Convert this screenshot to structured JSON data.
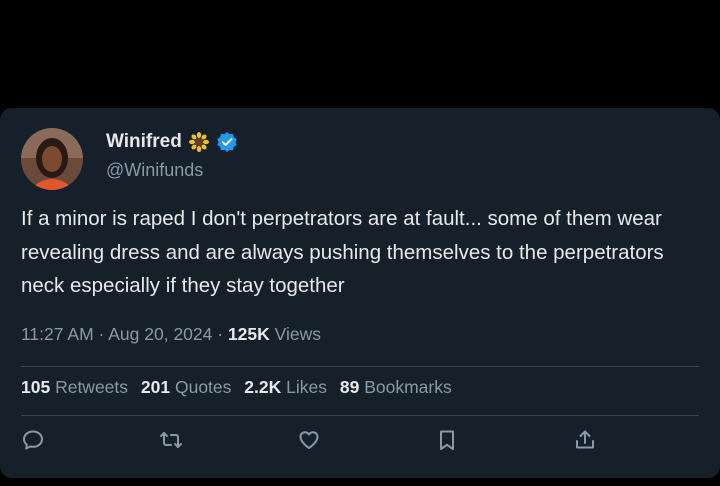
{
  "user": {
    "display_name": "Winifred",
    "name_emoji": "sunflower",
    "verified": true,
    "handle": "@Winifunds"
  },
  "tweet": {
    "text": "If a minor is raped I don't perpetrators are at fault... some of them wear revealing dress and are always pushing themselves to the perpetrators neck especially if they stay together",
    "time": "11:27 AM",
    "date": "Aug 20, 2024",
    "views_count": "125K",
    "views_label": "Views"
  },
  "stats": {
    "retweets_count": "105",
    "retweets_label": "Retweets",
    "quotes_count": "201",
    "quotes_label": "Quotes",
    "likes_count": "2.2K",
    "likes_label": "Likes",
    "bookmarks_count": "89",
    "bookmarks_label": "Bookmarks"
  },
  "actions": [
    "reply-icon",
    "retweet-icon",
    "like-icon",
    "bookmark-icon",
    "share-icon"
  ],
  "colors": {
    "background": "#000000",
    "card": "#15202b",
    "text_primary": "#e7e9ea",
    "text_secondary": "#8b98a5",
    "verified_blue": "#1d9bf0"
  }
}
